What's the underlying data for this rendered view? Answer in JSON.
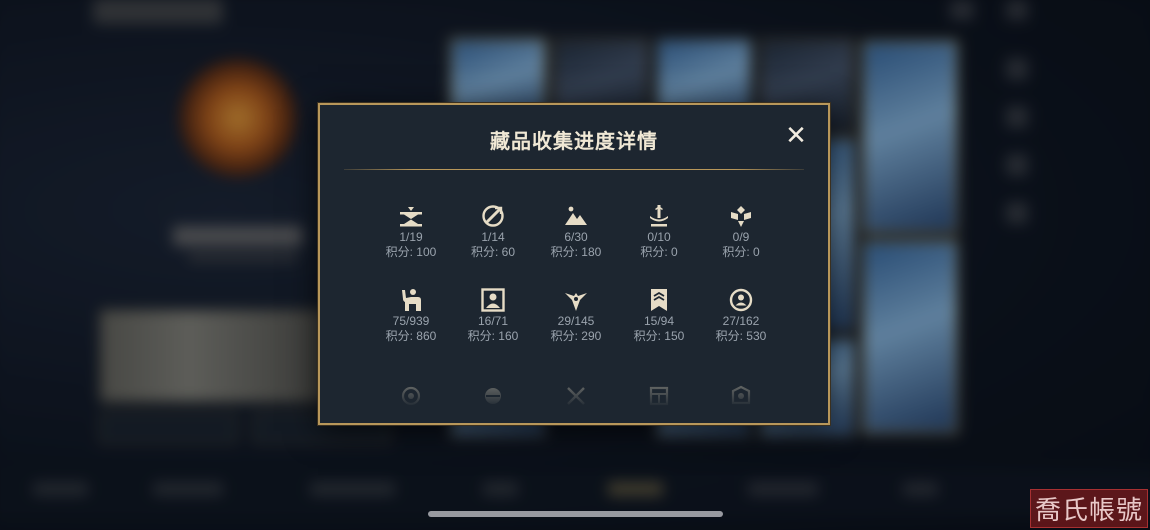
{
  "modal": {
    "title": "藏品收集进度详情",
    "close_label": "✕",
    "categories": [
      {
        "icon": "balance-icon",
        "count": "1/19",
        "points": "积分: 100"
      },
      {
        "icon": "ward-sword-icon",
        "count": "1/14",
        "points": "积分: 60"
      },
      {
        "icon": "mountain-icon",
        "count": "6/30",
        "points": "积分: 180"
      },
      {
        "icon": "fountain-icon",
        "count": "0/10",
        "points": "积分: 0"
      },
      {
        "icon": "emblem-icon",
        "count": "0/9",
        "points": "积分: 0"
      },
      {
        "icon": "champion-pose-icon",
        "count": "75/939",
        "points": "积分: 860"
      },
      {
        "icon": "portrait-icon",
        "count": "16/71",
        "points": "积分: 160"
      },
      {
        "icon": "winged-emblem-icon",
        "count": "29/145",
        "points": "积分: 290"
      },
      {
        "icon": "banner-icon",
        "count": "15/94",
        "points": "积分: 150"
      },
      {
        "icon": "profile-circle-icon",
        "count": "27/162",
        "points": "积分: 530"
      }
    ],
    "partial_row_icons": [
      "target-icon",
      "orb-icon",
      "crossed-swords-icon",
      "frame-icon",
      "badge-icon"
    ]
  },
  "background": {
    "blurred": true
  },
  "watermark": "喬氏帳號",
  "colors": {
    "accent_gold": "#b8975a",
    "modal_bg": "#1d2630",
    "text_primary": "#f0e8d5",
    "text_secondary": "#9aa3ad"
  }
}
